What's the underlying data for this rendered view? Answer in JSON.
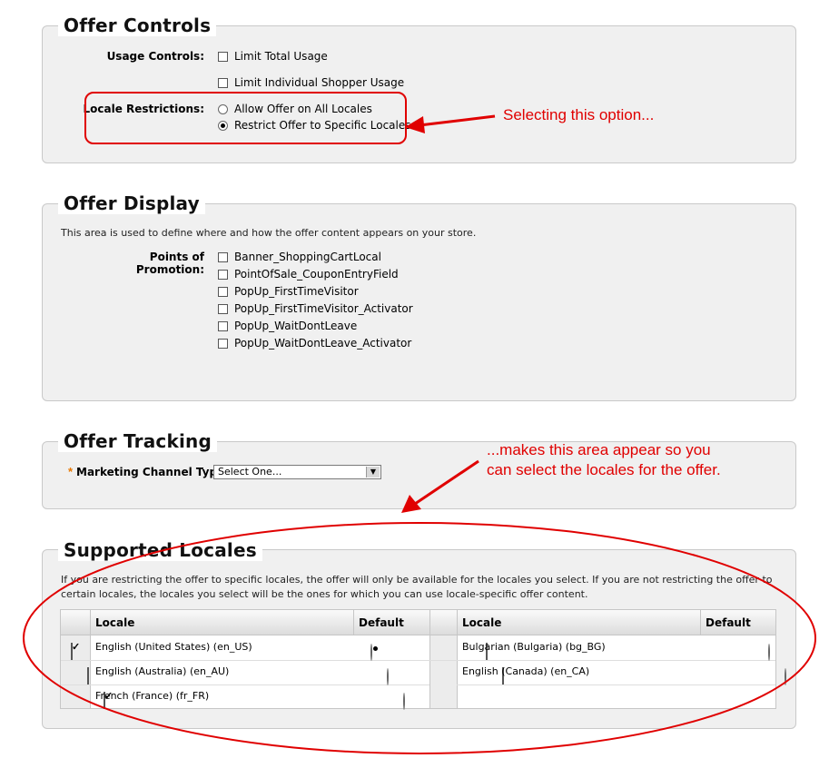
{
  "offer_controls": {
    "title": "Offer Controls",
    "usage_label": "Usage Controls:",
    "limit_total": "Limit Total Usage",
    "limit_individual": "Limit Individual Shopper Usage",
    "locale_label": "Locale Restrictions:",
    "allow_all": "Allow Offer on All Locales",
    "restrict_specific": "Restrict Offer to Specific Locales"
  },
  "offer_display": {
    "title": "Offer Display",
    "description": "This area is used to define where and how the offer content appears on your store.",
    "points_label": "Points of Promotion:",
    "points": [
      "Banner_ShoppingCartLocal",
      "PointOfSale_CouponEntryField",
      "PopUp_FirstTimeVisitor",
      "PopUp_FirstTimeVisitor_Activator",
      "PopUp_WaitDontLeave",
      "PopUp_WaitDontLeave_Activator"
    ]
  },
  "offer_tracking": {
    "title": "Offer Tracking",
    "required_mark": "*",
    "channel_label": "Marketing Channel Type:",
    "channel_value": "Select One..."
  },
  "supported_locales": {
    "title": "Supported Locales",
    "description_line1": "If you are restricting the offer to specific locales, the offer will only be available for the locales you select. If you are not restricting the offer to",
    "description_line2": "certain locales, the locales you select will be the ones for which you can use locale-specific offer content.",
    "header_locale": "Locale",
    "header_default": "Default",
    "left_rows": [
      {
        "name": "English (United States) (en_US)",
        "checked": true,
        "default": true
      },
      {
        "name": "English (Australia) (en_AU)",
        "checked": false,
        "default": false
      },
      {
        "name": "French (France) (fr_FR)",
        "checked": true,
        "default": false
      }
    ],
    "right_rows": [
      {
        "name": "Bulgarian (Bulgaria) (bg_BG)",
        "checked": false,
        "default": false
      },
      {
        "name": "English (Canada) (en_CA)",
        "checked": false,
        "default": false
      }
    ]
  },
  "annotations": {
    "note1": "Selecting this option...",
    "note2_line1": "...makes this area appear so you",
    "note2_line2": "can select the locales for the offer.",
    "color": "#e00000"
  }
}
